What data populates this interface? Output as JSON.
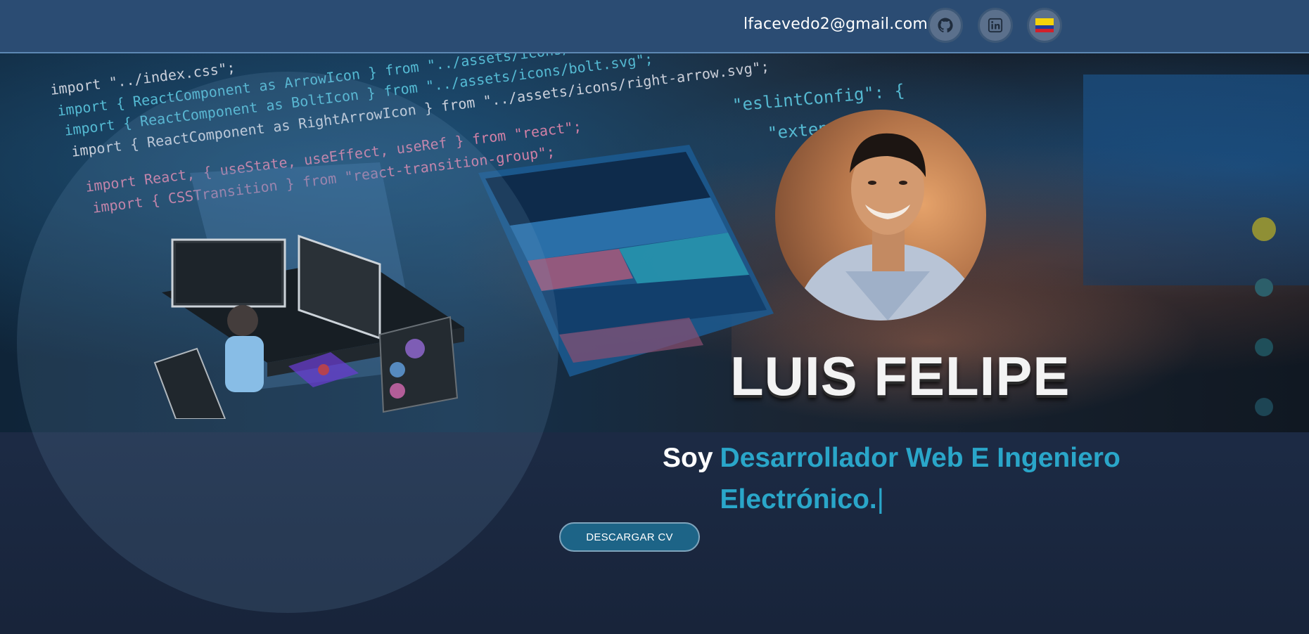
{
  "header": {
    "email": "lfacevedo2@gmail.com",
    "separator": "/",
    "social": [
      {
        "name": "github",
        "icon": "github-icon"
      },
      {
        "name": "linkedin",
        "icon": "linkedin-icon"
      },
      {
        "name": "language",
        "icon": "colombia-flag-icon"
      }
    ]
  },
  "hero": {
    "background_code": [
      "import \"../index.css\";",
      "import { ReactComponent as ArrowIcon } from \"../assets/icons/arrow.svg\";",
      "import { ReactComponent as BoltIcon } from \"../assets/icons/bolt.svg\";",
      "import { ReactComponent as RightArrowIcon } from \"../assets/icons/right-arrow.svg\";",
      "import React, { useState, useEffect, useRef } from \"react\";",
      "import { CSSTransition } from \"react-transition-group\";"
    ],
    "config_code": [
      "\"eslintConfig\": {",
      "\"extends\": ["
    ],
    "name": "LUIS FELIPE",
    "subtitle_lead": "Soy",
    "subtitle_role": "Desarrollador Web E Ingeniero Electrónico.",
    "caret": "|",
    "cta_label": "DESCARGAR CV"
  },
  "slider": {
    "dots": 4,
    "active_index": 0
  },
  "colors": {
    "header_bg": "#2b4c73",
    "accent_cyan": "#2aa6c9",
    "cta_bg": "#1d6487",
    "active_dot": "#8f8f35"
  }
}
